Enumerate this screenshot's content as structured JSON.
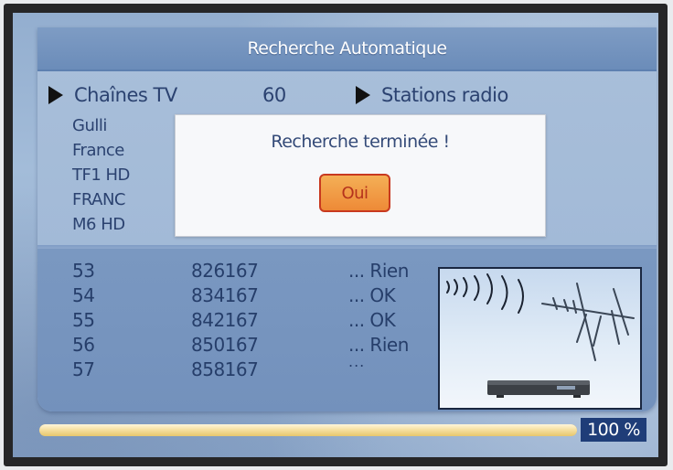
{
  "title": "Recherche Automatique",
  "header": {
    "tv_label": "Chaînes TV",
    "tv_count": "60",
    "radio_label": "Stations radio"
  },
  "channels": [
    "Gulli",
    "France",
    "TF1 HD",
    "FRANC",
    "M6 HD"
  ],
  "scan_rows": [
    {
      "num": "53",
      "freq": "826167",
      "status": "... Rien"
    },
    {
      "num": "54",
      "freq": "834167",
      "status": "... OK"
    },
    {
      "num": "55",
      "freq": "842167",
      "status": "... OK"
    },
    {
      "num": "56",
      "freq": "850167",
      "status": "... Rien"
    },
    {
      "num": "57",
      "freq": "858167",
      "status": ""
    }
  ],
  "scan_more": "...",
  "dialog": {
    "message": "Recherche terminée !",
    "button": "Oui"
  },
  "progress": {
    "value": 1.0,
    "label": "100 %"
  },
  "colors": {
    "accent": "#ee8a37",
    "title_bar": "#6b8cb9",
    "progress_label_bg": "#1f3d78"
  }
}
